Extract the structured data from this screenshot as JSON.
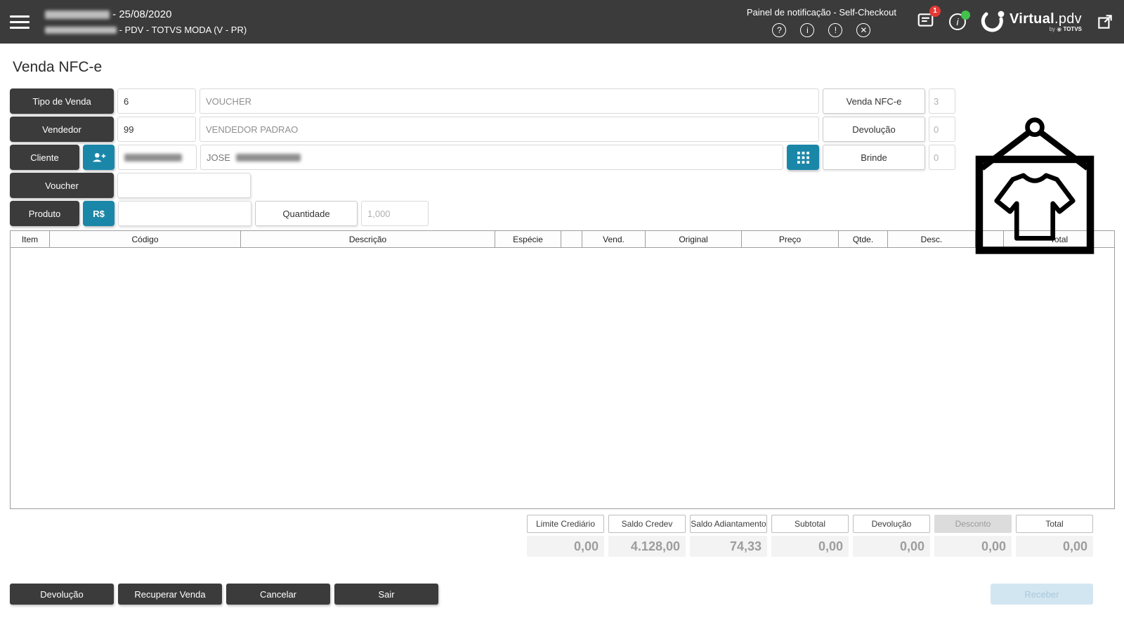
{
  "header": {
    "date_line": "- 25/08/2020",
    "pdv_line": "- PDV - TOTVS MODA (V - PR)",
    "panel_title": "Painel de notificação - Self-Checkout",
    "help_glyph": "?",
    "info_glyph": "i",
    "alert_glyph": "!",
    "close_glyph": "✕",
    "badge": "1",
    "logo_text": "Virtual",
    "logo_suffix": ".pdv",
    "logo_by": "by",
    "logo_brand": "TOTVS"
  },
  "page_title": "Venda NFC-e",
  "form": {
    "rows": {
      "tipo_venda": {
        "label": "Tipo de Venda",
        "code": "6",
        "desc": "VOUCHER"
      },
      "vendedor": {
        "label": "Vendedor",
        "code": "99",
        "desc": "VENDEDOR PADRAO"
      },
      "cliente": {
        "label": "Cliente",
        "desc_visible": "JOSE"
      },
      "voucher": {
        "label": "Voucher",
        "value": ""
      },
      "produto": {
        "label": "Produto",
        "currency": "R$",
        "value": ""
      },
      "quantidade": {
        "label": "Quantidade",
        "value": "1,000"
      }
    },
    "counters": [
      {
        "label": "Venda NFC-e",
        "value": "3"
      },
      {
        "label": "Devolução",
        "value": "0"
      },
      {
        "label": "Brinde",
        "value": "0"
      }
    ]
  },
  "table": {
    "columns": [
      "Item",
      "Código",
      "Descrição",
      "Espécie",
      "",
      "Vend.",
      "Original",
      "Preço",
      "Qtde.",
      "Desc.",
      "",
      "Total"
    ]
  },
  "summary": [
    {
      "label": "Limite Crediário",
      "value": "0,00"
    },
    {
      "label": "Saldo Credev",
      "value": "4.128,00"
    },
    {
      "label": "Saldo Adiantamento",
      "value": "74,33"
    },
    {
      "label": "Subtotal",
      "value": "0,00"
    },
    {
      "label": "Devolução",
      "value": "0,00"
    },
    {
      "label": "Desconto",
      "value": "0,00"
    },
    {
      "label": "Total",
      "value": "0,00"
    }
  ],
  "footer": {
    "buttons": [
      "Devolução",
      "Recuperar Venda",
      "Cancelar",
      "Sair"
    ],
    "receber": "Receber"
  },
  "colors": {
    "accent": "#1b87a8",
    "header": "#3b3b3b",
    "badge": "#e53935",
    "online": "#43c24c"
  }
}
